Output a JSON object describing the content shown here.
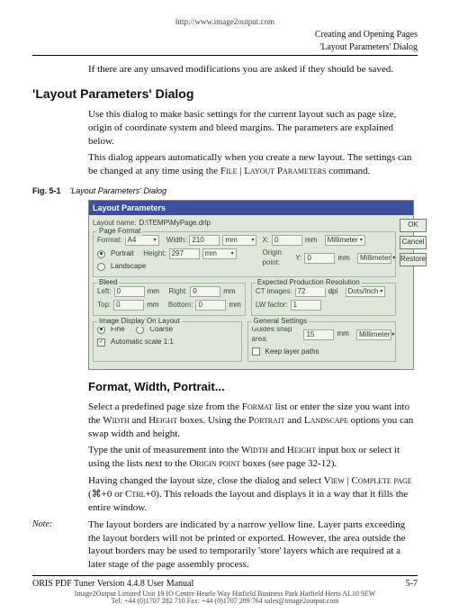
{
  "url": "http://www.image2output.com",
  "header": {
    "l1": "Creating and Opening Pages",
    "l2": "'Layout Parameters' Dialog"
  },
  "intro": "If there are any unsaved modifications you are asked if they should be saved.",
  "h2": "'Layout Parameters' Dialog",
  "p1": "Use this dialog to make basic settings for the current layout such as page size, origin of coordinate system and bleed margins. The parameters are explained below.",
  "p2a": "This dialog appears automatically when you create a new layout. The settings can be changed at any time using the ",
  "p2b": "File | Layout Parameters",
  "p2c": " command.",
  "fig": {
    "num": "Fig. 5-1",
    "cap": "'Layout Parameters' Dialog"
  },
  "dlg": {
    "title": "Layout Parameters",
    "ok": "OK",
    "cancel": "Cancel",
    "restore": "Restore",
    "layoutname_lbl": "Layout name:",
    "layoutname_val": "D:\\TEMP\\MyPage.drlp",
    "pageformat_lbl": "Page Format",
    "format_lbl": "Format:",
    "format_val": "A4",
    "width_lbl": "Width:",
    "width_val": "210",
    "width_unit": "mm",
    "height_lbl": "Height:",
    "height_val": "297",
    "height_unit": "mm",
    "portrait": "Portrait",
    "landscape": "Landscape",
    "origin_lbl": "Origin point:",
    "x_lbl": "X:",
    "x_val": "0",
    "x_unit": "mm",
    "y_lbl": "Y:",
    "y_val": "0",
    "y_unit": "mm",
    "unit_val": "Millimeter",
    "bleed_lbl": "Bleed",
    "left_lbl": "Left:",
    "left_val": "0",
    "right_lbl": "Right:",
    "right_val": "0",
    "top_lbl": "Top:",
    "top_val": "0",
    "bottom_lbl": "Bottom:",
    "bottom_val": "0",
    "mm": "mm",
    "expres_lbl": "Expected Production Resolution",
    "ct_lbl": "CT images:",
    "ct_val": "72",
    "ct_unit": "dpi",
    "lw_lbl": "LW factor:",
    "lw_val": "1",
    "imgdisp_lbl": "Image Display On Layout",
    "fine": "Fine",
    "coarse": "Coarse",
    "auto": "Automatic scale 1:1",
    "gen_lbl": "General Settings",
    "guides_lbl": "Guides snap area:",
    "guides_val": "15",
    "guides_unit": "mm",
    "keep": "Keep layer paths"
  },
  "h3": "Format, Width, Portrait...",
  "p3a": "Select a predefined page size from the ",
  "p3b": "Format",
  "p3c": " list or enter the size you want into the ",
  "p3d": "Width",
  "p3e": " and ",
  "p3f": "Height",
  "p3g": " boxes. Using the ",
  "p3h": "Portrait",
  "p3i": " and ",
  "p3j": "Landscape",
  "p3k": " options you can swap width and height.",
  "p4a": "Type the unit of measurement into the ",
  "p4b": "Width",
  "p4c": " and ",
  "p4d": "Height",
  "p4e": " input box or select it using the lists next to the ",
  "p4f": "Origin point",
  "p4g": " boxes (see page 32-12).",
  "p5a": "Having changed the layout size, close the dialog and select ",
  "p5b": "View | Complete page",
  "p5c": " (⌘+0 or ",
  "p5d": "Ctrl",
  "p5e": "+0). This reloads the layout and displays it in a way that it fills the entire window.",
  "note_lbl": "Note:",
  "note": "The layout borders are indicated by a narrow yellow line. Layer parts exceeding the layout borders will not be printed or exported. However, the area outside the layout borders may be used to temporarily 'store' layers which are required at a later stage of the page assembly process.",
  "footer_l": "ORIS PDF Tuner Version 4.4.8   User Manual",
  "footer_r": "5-7",
  "addr1": "Image2Output Limited  Unit 19 IO Centre Hearle Way Hatfield Business Park Hatfield Herts AL10 9EW",
  "addr2": "Tel: +44 (0)1707 282 710 Fax: +44 (0)1707 289 764 sales@image2output.com"
}
